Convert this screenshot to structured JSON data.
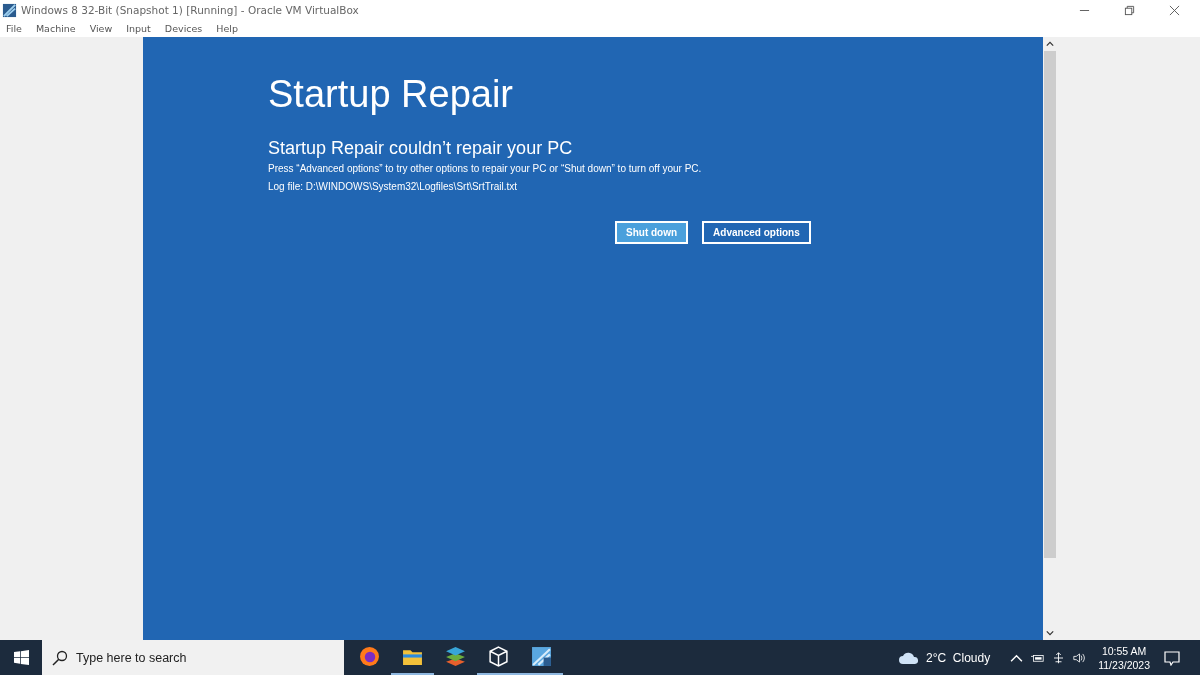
{
  "window": {
    "title": "Windows 8 32-Bit (Snapshot 1) [Running] - Oracle VM VirtualBox"
  },
  "menu": [
    "File",
    "Machine",
    "View",
    "Input",
    "Devices",
    "Help"
  ],
  "screen": {
    "heading": "Startup Repair",
    "subheading": "Startup Repair couldn’t repair your PC",
    "message": "Press “Advanced options” to try other options to repair your PC or “Shut down” to turn off your PC.",
    "log": "Log file: D:\\WINDOWS\\System32\\Logfiles\\Srt\\SrtTrail.txt",
    "buttons": [
      {
        "label": "Shut down",
        "focused": true
      },
      {
        "label": "Advanced options",
        "focused": false
      }
    ]
  },
  "taskbar": {
    "search_placeholder": "Type here to search",
    "apps": [
      {
        "kind": "firefox",
        "running": false
      },
      {
        "kind": "explorer",
        "running": true
      },
      {
        "kind": "layers",
        "running": false
      },
      {
        "kind": "cube",
        "running": true
      },
      {
        "kind": "vm",
        "running": true
      }
    ],
    "weather": "2°C  Cloudy",
    "time": "10:55 AM",
    "date": "11/23/2023"
  }
}
